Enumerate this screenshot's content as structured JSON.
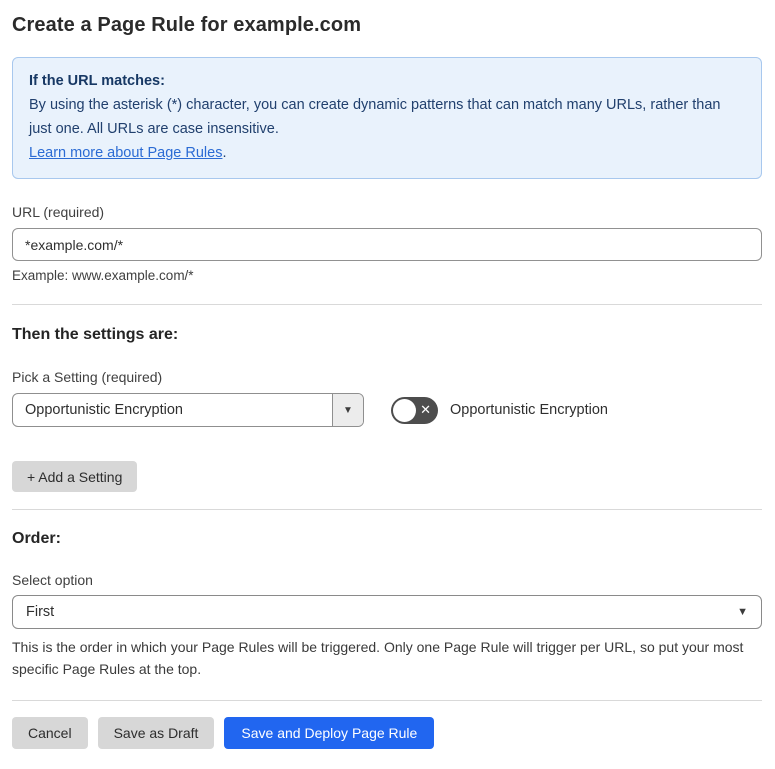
{
  "page": {
    "title": "Create a Page Rule for example.com"
  },
  "callout": {
    "heading": "If the URL matches:",
    "body": "By using the asterisk (*) character, you can create dynamic patterns that can match many URLs, rather than just one. All URLs are case insensitive.",
    "link_label": "Learn more about Page Rules",
    "link_suffix": "."
  },
  "url_field": {
    "label": "URL (required)",
    "value": "*example.com/*",
    "example": "Example: www.example.com/*"
  },
  "settings": {
    "heading": "Then the settings are:",
    "picker_label": "Pick a Setting (required)",
    "selected_setting": "Opportunistic Encryption",
    "toggle_label": "Opportunistic Encryption",
    "toggle_state": "off",
    "add_setting_label": "+ Add a Setting"
  },
  "order": {
    "heading": "Order:",
    "select_label": "Select option",
    "selected_option": "First",
    "help_text": "This is the order in which your Page Rules will be triggered. Only one Page Rule will trigger per URL, so put your most specific Page Rules at the top."
  },
  "footer": {
    "cancel_label": "Cancel",
    "save_draft_label": "Save as Draft",
    "save_deploy_label": "Save and Deploy Page Rule"
  },
  "icons": {
    "dropdown_arrow": "▼",
    "toggle_off_x": "✕"
  },
  "colors": {
    "primary_button_blue": "#2166f0",
    "callout_background": "#e9f2fc",
    "callout_border": "#a8c8ee",
    "callout_text": "#21406e",
    "link_blue": "#2b6bd4",
    "toggle_off_background": "#4d4d4d",
    "secondary_button_gray": "#d7d7d7"
  }
}
